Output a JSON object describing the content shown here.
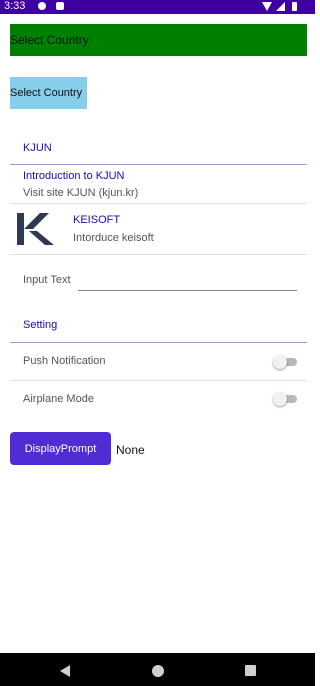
{
  "status_bar": {
    "time": "3:33",
    "icons": [
      "privacy-icon",
      "notification-icon",
      "wifi-icon",
      "signal-icon",
      "battery-icon"
    ]
  },
  "pickers": {
    "green": {
      "label": "Select Country",
      "color": "#008000"
    },
    "blue": {
      "label": "Select Country",
      "color": "#87ceeb"
    }
  },
  "table": {
    "kjun_section": {
      "header": "KJUN",
      "text_cell": {
        "title": "Introduction to KJUN",
        "detail": "Visit site KJUN (kjun.kr)"
      },
      "image_cell": {
        "title": "KEISOFT",
        "detail": "Intorduce keisoft",
        "icon": "keisoft-logo-icon"
      },
      "entry_cell": {
        "label": "Input Text",
        "value": ""
      }
    },
    "setting_section": {
      "header": "Setting",
      "switches": [
        {
          "label": "Push Notification",
          "on": false
        },
        {
          "label": "Airplane Mode",
          "on": false
        }
      ]
    }
  },
  "prompt": {
    "button_label": "DisplayPrompt",
    "result": "None",
    "accent": "#512bd4"
  },
  "nav_bar": {
    "icons": [
      "back-icon",
      "home-icon",
      "recents-icon"
    ]
  }
}
